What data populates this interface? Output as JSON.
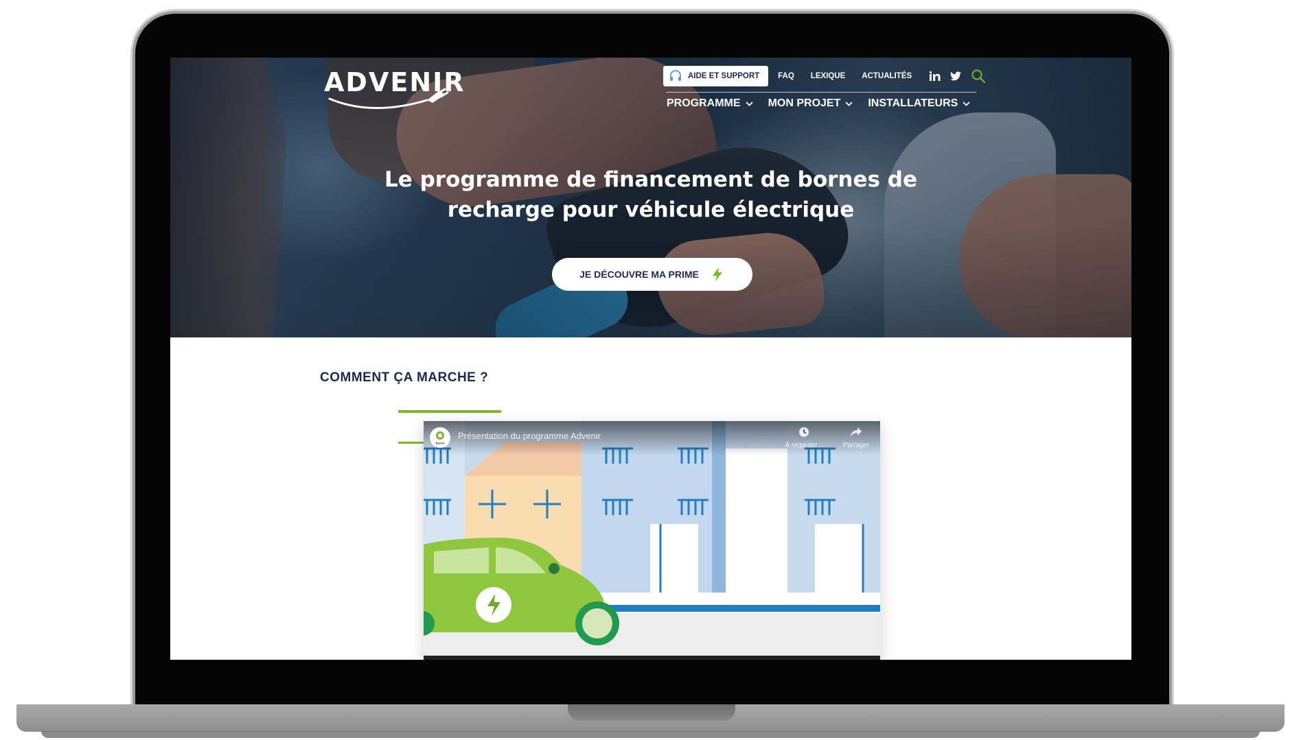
{
  "brand": {
    "name": "ADVENIR"
  },
  "header": {
    "support_label": "AIDE ET SUPPORT",
    "links": [
      "FAQ",
      "LEXIQUE",
      "ACTUALITÉS"
    ],
    "main_nav": [
      "PROGRAMME",
      "MON PROJET",
      "INSTALLATEURS"
    ]
  },
  "hero": {
    "title": "Le programme de financement de bornes de recharge pour véhicule électrique",
    "cta_label": "JE DÉCOUVRE MA PRIME"
  },
  "section": {
    "title": "COMMENT ÇA MARCHE ?"
  },
  "video": {
    "title": "Présentation du programme Advenir",
    "channel_label": "Avere",
    "watch_later_label": "À regarder...",
    "share_label": "Partager"
  },
  "colors": {
    "navy": "#1b2a4e",
    "green": "#7ab929",
    "hero_overlay": "#1f3345"
  },
  "icons": [
    "headset-icon",
    "linkedin-icon",
    "twitter-icon",
    "search-icon",
    "chevron-down-icon",
    "lightning-icon",
    "clock-icon",
    "share-icon"
  ]
}
